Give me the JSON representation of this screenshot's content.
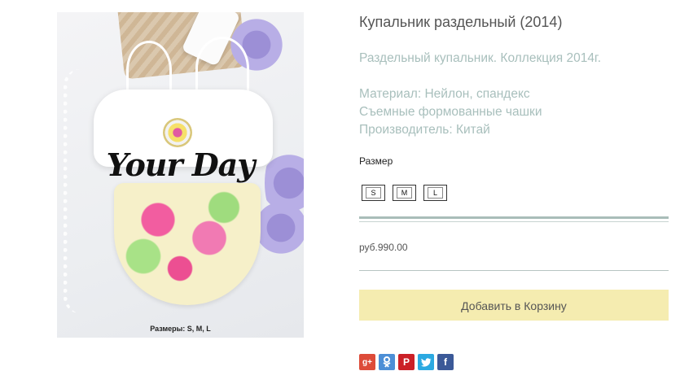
{
  "product": {
    "title": "Купальник раздельный (2014)",
    "description_lines": [
      "Раздельный купальник. Коллекция 2014г.",
      "",
      "Материал: Нейлон, спандекс",
      "Съемные формованные чашки",
      "Производитель: Китай"
    ],
    "image": {
      "brand_text": "Your Day",
      "caption": "Размеры: S, M, L"
    },
    "size_label": "Размер",
    "sizes": [
      "S",
      "M",
      "L"
    ],
    "price": "руб.990.00",
    "add_to_cart_label": "Добавить в Корзину"
  },
  "social": {
    "icons": [
      "google-plus-icon",
      "odnoklassniki-icon",
      "pinterest-icon",
      "twitter-icon",
      "facebook-icon"
    ]
  },
  "colors": {
    "cart_button_bg": "#f5ecb0",
    "description_text": "#a8bfbc",
    "rule": "#a9bdb9"
  }
}
